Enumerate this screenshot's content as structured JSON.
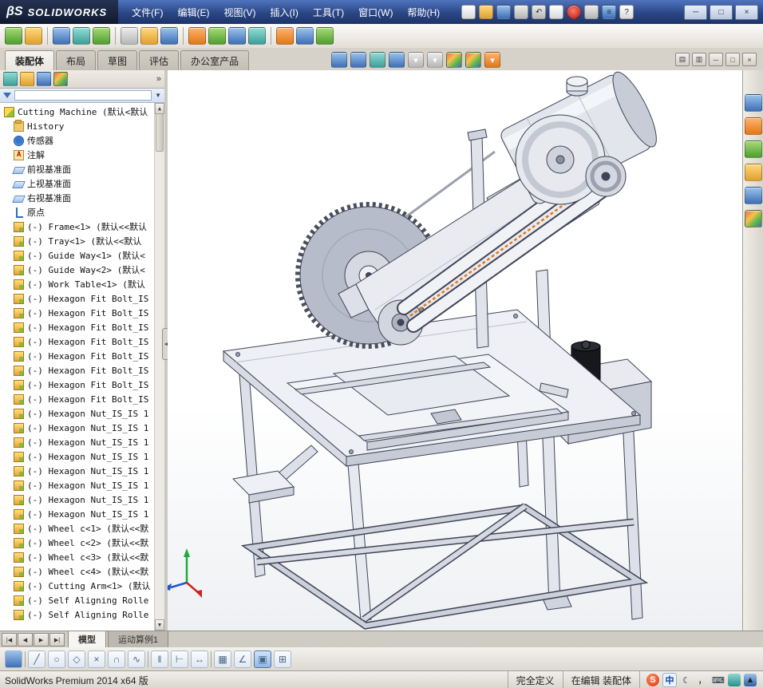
{
  "titlebar": {
    "logo_glyph": "βS",
    "brand": "SOLIDWORKS",
    "menus": [
      {
        "label": "文件(F)"
      },
      {
        "label": "编辑(E)"
      },
      {
        "label": "视图(V)"
      },
      {
        "label": "插入(I)"
      },
      {
        "label": "工具(T)"
      },
      {
        "label": "窗口(W)"
      },
      {
        "label": "帮助(H)"
      }
    ],
    "quick_icons": [
      {
        "name": "new-document-icon",
        "cls": "qchip w",
        "glyph": "",
        "inter": "true"
      },
      {
        "name": "open-icon",
        "cls": "qchip y",
        "glyph": "",
        "inter": "true"
      },
      {
        "name": "save-icon",
        "cls": "qchip b",
        "glyph": "",
        "inter": "true"
      },
      {
        "name": "print-icon",
        "cls": "qchip gr",
        "glyph": "",
        "inter": "true"
      },
      {
        "name": "undo-icon",
        "cls": "qchip gr",
        "glyph": "↶",
        "inter": "true"
      },
      {
        "name": "select-cursor-icon",
        "cls": "qchip w",
        "glyph": "",
        "inter": "true"
      },
      {
        "name": "record-macro-icon",
        "cls": "qchip rdot",
        "glyph": "",
        "inter": "true"
      },
      {
        "name": "options-icon",
        "cls": "qchip gr",
        "glyph": "",
        "inter": "true"
      },
      {
        "name": "list-icon",
        "cls": "qchip b",
        "glyph": "≡",
        "inter": "true"
      },
      {
        "name": "help-icon",
        "cls": "qchip w",
        "glyph": "?",
        "inter": "true"
      }
    ],
    "window_controls": {
      "minimize": "─",
      "maximize": "□",
      "close": "×"
    }
  },
  "assembly_toolbar": {
    "icons": [
      {
        "name": "insert-component-icon",
        "cls": "chip g",
        "glyph": "",
        "inter": "true"
      },
      {
        "name": "mate-icon",
        "cls": "chip y",
        "glyph": "",
        "inter": "true"
      },
      {
        "name": "separator",
        "cls": "sep",
        "glyph": "",
        "inter": "false"
      },
      {
        "name": "linear-component-pattern-icon",
        "cls": "chip b",
        "glyph": "",
        "inter": "true"
      },
      {
        "name": "smart-fasteners-icon",
        "cls": "chip t",
        "glyph": "",
        "inter": "true"
      },
      {
        "name": "move-component-icon",
        "cls": "chip g",
        "glyph": "",
        "inter": "true"
      },
      {
        "name": "separator",
        "cls": "sep",
        "glyph": "",
        "inter": "false"
      },
      {
        "name": "show-hidden-components-icon",
        "cls": "chip gr",
        "glyph": "",
        "inter": "true"
      },
      {
        "name": "assembly-features-icon",
        "cls": "chip y",
        "glyph": "",
        "inter": "true"
      },
      {
        "name": "reference-geometry-icon",
        "cls": "chip b",
        "glyph": "",
        "inter": "true"
      },
      {
        "name": "separator",
        "cls": "sep",
        "glyph": "",
        "inter": "false"
      },
      {
        "name": "new-motion-study-icon",
        "cls": "chip o",
        "glyph": "",
        "inter": "true"
      },
      {
        "name": "bill-of-materials-icon",
        "cls": "chip g",
        "glyph": "",
        "inter": "true"
      },
      {
        "name": "exploded-view-icon",
        "cls": "chip b",
        "glyph": "",
        "inter": "true"
      },
      {
        "name": "instant3d-icon",
        "cls": "chip t",
        "glyph": "",
        "inter": "true"
      },
      {
        "name": "separator",
        "cls": "sep",
        "glyph": "",
        "inter": "false"
      },
      {
        "name": "update-speedpak-icon",
        "cls": "chip o",
        "glyph": "",
        "inter": "true"
      },
      {
        "name": "take-snapshot-icon",
        "cls": "chip b",
        "glyph": "",
        "inter": "true"
      },
      {
        "name": "large-design-review-icon",
        "cls": "chip g",
        "glyph": "",
        "inter": "true"
      }
    ]
  },
  "command_tabs": {
    "tabs": [
      {
        "label": "装配体",
        "cls": "tab active",
        "inter": "true"
      },
      {
        "label": "布局",
        "cls": "tab",
        "inter": "true"
      },
      {
        "label": "草图",
        "cls": "tab",
        "inter": "true"
      },
      {
        "label": "评估",
        "cls": "tab",
        "inter": "true"
      },
      {
        "label": "办公室产品",
        "cls": "tab",
        "inter": "true"
      }
    ]
  },
  "headsup_toolbar": {
    "icons": [
      {
        "name": "zoom-to-fit-icon",
        "cls": "chip hu b",
        "glyph": "",
        "inter": "true"
      },
      {
        "name": "zoom-to-area-icon",
        "cls": "chip hu b",
        "glyph": "",
        "inter": "true"
      },
      {
        "name": "previous-view-icon",
        "cls": "chip hu t",
        "glyph": "",
        "inter": "true"
      },
      {
        "name": "section-view-icon",
        "cls": "chip hu b",
        "glyph": "",
        "inter": "true"
      },
      {
        "name": "view-orientation-icon",
        "cls": "chip hu gr",
        "glyph": "▾",
        "inter": "true"
      },
      {
        "name": "display-style-icon",
        "cls": "chip hu gr",
        "glyph": "▾",
        "inter": "true"
      },
      {
        "name": "hide-show-items-icon",
        "cls": "chip hu m",
        "glyph": "",
        "inter": "true"
      },
      {
        "name": "edit-appearance-icon",
        "cls": "chip hu m",
        "glyph": "",
        "inter": "true"
      },
      {
        "name": "view-settings-icon",
        "cls": "chip hu o",
        "glyph": "▾",
        "inter": "true"
      }
    ]
  },
  "document_controls": {
    "icons": [
      {
        "name": "cascade-windows-icon",
        "glyph": "▤",
        "inter": "true"
      },
      {
        "name": "tile-windows-icon",
        "glyph": "▥",
        "inter": "true"
      },
      {
        "name": "minimize-document-icon",
        "glyph": "─",
        "inter": "true"
      },
      {
        "name": "restore-document-icon",
        "glyph": "□",
        "inter": "true"
      },
      {
        "name": "close-document-icon",
        "glyph": "×",
        "inter": "true"
      }
    ]
  },
  "panel": {
    "tabs": [
      {
        "name": "featuremanager-tab-icon",
        "cls": "ptab t",
        "inter": "true"
      },
      {
        "name": "propertymanager-tab-icon",
        "cls": "ptab y",
        "inter": "true"
      },
      {
        "name": "configurationmanager-tab-icon",
        "cls": "ptab b",
        "inter": "true"
      },
      {
        "name": "displaymanager-tab-icon",
        "cls": "ptab m",
        "inter": "true"
      }
    ],
    "overflow_glyph": "»",
    "filter_caret": "▼",
    "scroll_up": "▲",
    "scroll_down": "▼",
    "splitter_glyph": "◀"
  },
  "feature_tree": {
    "items": [
      {
        "name": "tree-item-root",
        "icon": "assembly-icon",
        "icls": "ti i-root",
        "cls": "trow lvl0",
        "label": "Cutting Machine (默认<默认"
      },
      {
        "name": "tree-item-history",
        "icon": "history-folder-icon",
        "icls": "ti i-hist",
        "cls": "trow lvl1",
        "label": "History"
      },
      {
        "name": "tree-item-sensors",
        "icon": "sensors-icon",
        "icls": "ti i-sensor",
        "cls": "trow lvl1",
        "label": "传感器"
      },
      {
        "name": "tree-item-annotations",
        "icon": "annotations-folder-icon",
        "icls": "ti i-annfolder",
        "cls": "trow lvl1",
        "label": "注解"
      },
      {
        "name": "tree-item-plane-front",
        "icon": "plane-icon",
        "icls": "ti i-plane",
        "cls": "trow lvl1",
        "label": "前视基准面"
      },
      {
        "name": "tree-item-plane-top",
        "icon": "plane-icon",
        "icls": "ti i-plane",
        "cls": "trow lvl1",
        "label": "上视基准面"
      },
      {
        "name": "tree-item-plane-right",
        "icon": "plane-icon",
        "icls": "ti i-plane",
        "cls": "trow lvl1",
        "label": "右视基准面"
      },
      {
        "name": "tree-item-origin",
        "icon": "origin-icon",
        "icls": "ti i-origin",
        "cls": "trow lvl1",
        "label": "原点"
      },
      {
        "name": "tree-item-component",
        "icon": "component-icon",
        "icls": "ti i-part",
        "cls": "trow lvl1",
        "label": "(-) Frame<1> (默认<<默认"
      },
      {
        "name": "tree-item-component",
        "icon": "component-icon",
        "icls": "ti i-part",
        "cls": "trow lvl1",
        "label": "(-) Tray<1> (默认<<默认"
      },
      {
        "name": "tree-item-component",
        "icon": "component-icon",
        "icls": "ti i-part",
        "cls": "trow lvl1",
        "label": "(-) Guide Way<1> (默认<"
      },
      {
        "name": "tree-item-component",
        "icon": "component-icon",
        "icls": "ti i-part",
        "cls": "trow lvl1",
        "label": "(-) Guide Way<2> (默认<"
      },
      {
        "name": "tree-item-component",
        "icon": "component-icon",
        "icls": "ti i-part",
        "cls": "trow lvl1",
        "label": "(-) Work Table<1> (默认"
      },
      {
        "name": "tree-item-component",
        "icon": "component-icon",
        "icls": "ti i-part",
        "cls": "trow lvl1",
        "label": "(-) Hexagon Fit Bolt_IS"
      },
      {
        "name": "tree-item-component",
        "icon": "component-icon",
        "icls": "ti i-part",
        "cls": "trow lvl1",
        "label": "(-) Hexagon Fit Bolt_IS"
      },
      {
        "name": "tree-item-component",
        "icon": "component-icon",
        "icls": "ti i-part",
        "cls": "trow lvl1",
        "label": "(-) Hexagon Fit Bolt_IS"
      },
      {
        "name": "tree-item-component",
        "icon": "component-icon",
        "icls": "ti i-part",
        "cls": "trow lvl1",
        "label": "(-) Hexagon Fit Bolt_IS"
      },
      {
        "name": "tree-item-component",
        "icon": "component-icon",
        "icls": "ti i-part",
        "cls": "trow lvl1",
        "label": "(-) Hexagon Fit Bolt_IS"
      },
      {
        "name": "tree-item-component",
        "icon": "component-icon",
        "icls": "ti i-part",
        "cls": "trow lvl1",
        "label": "(-) Hexagon Fit Bolt_IS"
      },
      {
        "name": "tree-item-component",
        "icon": "component-icon",
        "icls": "ti i-part",
        "cls": "trow lvl1",
        "label": "(-) Hexagon Fit Bolt_IS"
      },
      {
        "name": "tree-item-component",
        "icon": "component-icon",
        "icls": "ti i-part",
        "cls": "trow lvl1",
        "label": "(-) Hexagon Fit Bolt_IS"
      },
      {
        "name": "tree-item-component",
        "icon": "component-icon",
        "icls": "ti i-part",
        "cls": "trow lvl1",
        "label": "(-) Hexagon Nut_IS_IS 1"
      },
      {
        "name": "tree-item-component",
        "icon": "component-icon",
        "icls": "ti i-part",
        "cls": "trow lvl1",
        "label": "(-) Hexagon Nut_IS_IS 1"
      },
      {
        "name": "tree-item-component",
        "icon": "component-icon",
        "icls": "ti i-part",
        "cls": "trow lvl1",
        "label": "(-) Hexagon Nut_IS_IS 1"
      },
      {
        "name": "tree-item-component",
        "icon": "component-icon",
        "icls": "ti i-part",
        "cls": "trow lvl1",
        "label": "(-) Hexagon Nut_IS_IS 1"
      },
      {
        "name": "tree-item-component",
        "icon": "component-icon",
        "icls": "ti i-part",
        "cls": "trow lvl1",
        "label": "(-) Hexagon Nut_IS_IS 1"
      },
      {
        "name": "tree-item-component",
        "icon": "component-icon",
        "icls": "ti i-part",
        "cls": "trow lvl1",
        "label": "(-) Hexagon Nut_IS_IS 1"
      },
      {
        "name": "tree-item-component",
        "icon": "component-icon",
        "icls": "ti i-part",
        "cls": "trow lvl1",
        "label": "(-) Hexagon Nut_IS_IS 1"
      },
      {
        "name": "tree-item-component",
        "icon": "component-icon",
        "icls": "ti i-part",
        "cls": "trow lvl1",
        "label": "(-) Hexagon Nut_IS_IS 1"
      },
      {
        "name": "tree-item-component",
        "icon": "component-icon",
        "icls": "ti i-part",
        "cls": "trow lvl1",
        "label": "(-) Wheel c<1> (默认<<默"
      },
      {
        "name": "tree-item-component",
        "icon": "component-icon",
        "icls": "ti i-part",
        "cls": "trow lvl1",
        "label": "(-) Wheel c<2> (默认<<默"
      },
      {
        "name": "tree-item-component",
        "icon": "component-icon",
        "icls": "ti i-part",
        "cls": "trow lvl1",
        "label": "(-) Wheel c<3> (默认<<默"
      },
      {
        "name": "tree-item-component",
        "icon": "component-icon",
        "icls": "ti i-part",
        "cls": "trow lvl1",
        "label": "(-) Wheel c<4> (默认<<默"
      },
      {
        "name": "tree-item-component",
        "icon": "component-icon",
        "icls": "ti i-part",
        "cls": "trow lvl1",
        "label": "(-) Cutting Arm<1> (默认"
      },
      {
        "name": "tree-item-component",
        "icon": "component-icon",
        "icls": "ti i-part",
        "cls": "trow lvl1",
        "label": "(-) Self Aligning Rolle"
      },
      {
        "name": "tree-item-component",
        "icon": "component-icon",
        "icls": "ti i-part",
        "cls": "trow lvl1",
        "label": "(-) Self Aligning Rolle"
      }
    ]
  },
  "task_pane": {
    "icons": [
      {
        "name": "task-pane-expand-icon",
        "cls": "chip tpc b",
        "glyph": "",
        "inter": "true"
      },
      {
        "name": "solidworks-resources-home-icon",
        "cls": "chip tpc o",
        "glyph": "",
        "inter": "true"
      },
      {
        "name": "design-library-icon",
        "cls": "chip tpc g",
        "glyph": "",
        "inter": "true"
      },
      {
        "name": "file-explorer-icon",
        "cls": "chip tpc y",
        "glyph": "",
        "inter": "true"
      },
      {
        "name": "view-palette-icon",
        "cls": "chip tpc b",
        "glyph": "",
        "inter": "true"
      },
      {
        "name": "appearances-scenes-icon",
        "cls": "chip tpc m",
        "glyph": "",
        "inter": "true"
      }
    ]
  },
  "bottom_tabs": {
    "nav": [
      {
        "glyph": "|◀",
        "name": "first-study-button",
        "inter": "true"
      },
      {
        "glyph": "◀",
        "name": "previous-study-button",
        "inter": "true"
      },
      {
        "glyph": "▶",
        "name": "next-study-button",
        "inter": "true"
      },
      {
        "glyph": "▶|",
        "name": "last-study-button",
        "inter": "true"
      }
    ],
    "tabs": [
      {
        "label": "模型",
        "cls": "btab active",
        "inter": "true"
      },
      {
        "label": "运动算例1",
        "cls": "btab",
        "inter": "true"
      }
    ]
  },
  "sketch_toolbar": {
    "icons": [
      {
        "name": "save-icon",
        "cls": "sk skblue",
        "glyph": "",
        "inter": "true"
      },
      {
        "name": "separator",
        "cls": "sksep",
        "glyph": "",
        "inter": "false"
      },
      {
        "name": "line-icon",
        "cls": "sk",
        "glyph": "╱",
        "inter": "true"
      },
      {
        "name": "circle-icon",
        "cls": "sk",
        "glyph": "○",
        "inter": "true"
      },
      {
        "name": "polygon-icon",
        "cls": "sk",
        "glyph": "◇",
        "inter": "true"
      },
      {
        "name": "delete-icon",
        "cls": "sk",
        "glyph": "×",
        "inter": "true"
      },
      {
        "name": "arc-icon",
        "cls": "sk",
        "glyph": "∩",
        "inter": "true"
      },
      {
        "name": "spline-icon",
        "cls": "sk",
        "glyph": "∿",
        "inter": "true"
      },
      {
        "name": "separator",
        "cls": "sksep",
        "glyph": "",
        "inter": "false"
      },
      {
        "name": "mirror-entities-icon",
        "cls": "sk",
        "glyph": "‖",
        "inter": "true"
      },
      {
        "name": "trim-entities-icon",
        "cls": "sk",
        "glyph": "⊢",
        "inter": "true"
      },
      {
        "name": "smart-dimension-icon",
        "cls": "sk",
        "glyph": "↔",
        "inter": "true"
      },
      {
        "name": "separator",
        "cls": "sksep",
        "glyph": "",
        "inter": "false"
      },
      {
        "name": "grid-snap-icon",
        "cls": "sk",
        "glyph": "▦",
        "inter": "true"
      },
      {
        "name": "angle-snap-icon",
        "cls": "sk",
        "glyph": "∠",
        "inter": "true"
      },
      {
        "name": "view-cube-icon",
        "cls": "sk sel",
        "glyph": "▣",
        "inter": "true"
      },
      {
        "name": "table-icon",
        "cls": "sk",
        "glyph": "⊞",
        "inter": "true"
      }
    ]
  },
  "statusbar": {
    "app": "SolidWorks Premium 2014 x64 版",
    "define_state": "完全定义",
    "edit_state": "在编辑  装配体",
    "ime": [
      {
        "name": "sogou-ime-icon",
        "cls": "ime ime-s",
        "glyph": "S",
        "inter": "true"
      },
      {
        "name": "ime-language-icon",
        "cls": "ime ime-zh",
        "glyph": "中",
        "inter": "true"
      },
      {
        "name": "ime-fullwidth-icon",
        "cls": "ime ime-pl",
        "glyph": "☾",
        "inter": "true"
      },
      {
        "name": "ime-punctuation-icon",
        "cls": "ime ime-pl",
        "glyph": "，",
        "inter": "true"
      },
      {
        "name": "ime-keyboard-icon",
        "cls": "ime ime-pl",
        "glyph": "⌨",
        "inter": "true"
      },
      {
        "name": "ime-toolbox-icon",
        "cls": "ime ime-tl",
        "glyph": "",
        "inter": "true"
      },
      {
        "name": "tray-up-icon",
        "cls": "ime ime-bl",
        "glyph": "▲",
        "inter": "true"
      }
    ]
  }
}
